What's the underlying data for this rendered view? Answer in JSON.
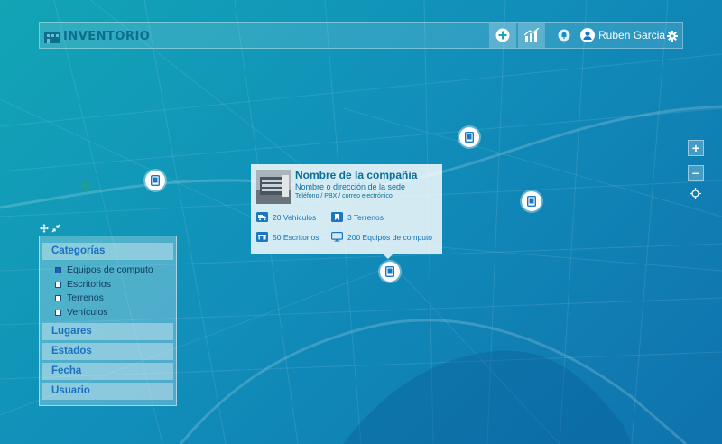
{
  "header": {
    "logo_text": "INVENTORIO",
    "add_icon": "plus-circle-icon",
    "chart_icon": "bar-chart-icon",
    "notification_icon": "bell-icon",
    "user_name": "Ruben Garcia",
    "settings_icon": "gear-icon"
  },
  "map_controls": {
    "zoom_in": "+",
    "zoom_out": "−",
    "locate_icon": "crosshair-icon"
  },
  "popup": {
    "title": "Nombre de la compañia",
    "subtitle": "Nombre o dirección de la sede",
    "contact": "Teléfono / PBX / correo electrónico",
    "stats": [
      {
        "icon": "truck-icon",
        "label": "20 Vehiculos"
      },
      {
        "icon": "bookmark-icon",
        "label": "3 Terrenos"
      },
      {
        "icon": "desk-icon",
        "label": "50 Escritorios"
      },
      {
        "icon": "monitor-icon",
        "label": "200 Equipos de computo"
      }
    ]
  },
  "panel": {
    "move_icon": "move-icon",
    "collapse_icon": "collapse-arrows-icon",
    "categories_title": "Categorías",
    "categories": [
      {
        "label": "Equipos de computo",
        "checked": true
      },
      {
        "label": "Escritorios",
        "checked": false
      },
      {
        "label": "Terrenos",
        "checked": false
      },
      {
        "label": "Vehículos",
        "checked": false
      }
    ],
    "sections": [
      "Lugares",
      "Estados",
      "Fecha",
      "Usuario"
    ]
  },
  "colors": {
    "map_bg_light": "#12a5b5",
    "map_bg_dark": "#0f72ad",
    "accent_blue": "#1a6fc0",
    "title_teal": "#0d6e99"
  }
}
